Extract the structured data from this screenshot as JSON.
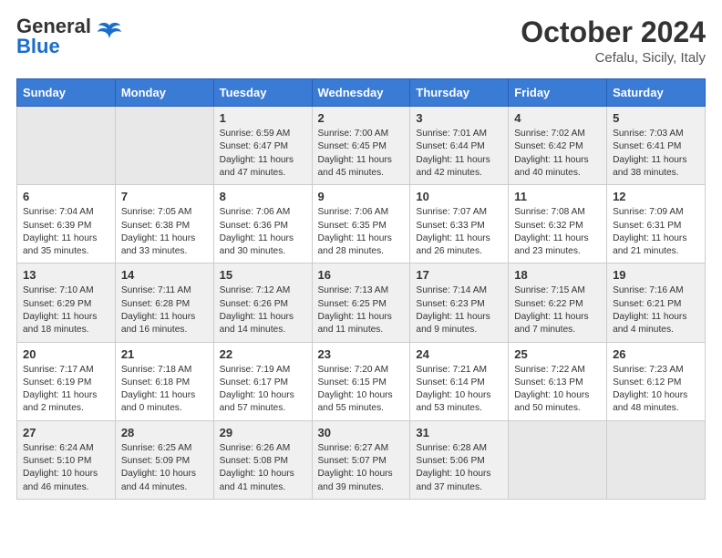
{
  "header": {
    "logo_general": "General",
    "logo_blue": "Blue",
    "month_title": "October 2024",
    "location": "Cefalu, Sicily, Italy"
  },
  "days_of_week": [
    "Sunday",
    "Monday",
    "Tuesday",
    "Wednesday",
    "Thursday",
    "Friday",
    "Saturday"
  ],
  "weeks": [
    [
      {
        "num": "",
        "empty": true
      },
      {
        "num": "",
        "empty": true
      },
      {
        "num": "1",
        "sunrise": "Sunrise: 6:59 AM",
        "sunset": "Sunset: 6:47 PM",
        "daylight": "Daylight: 11 hours and 47 minutes."
      },
      {
        "num": "2",
        "sunrise": "Sunrise: 7:00 AM",
        "sunset": "Sunset: 6:45 PM",
        "daylight": "Daylight: 11 hours and 45 minutes."
      },
      {
        "num": "3",
        "sunrise": "Sunrise: 7:01 AM",
        "sunset": "Sunset: 6:44 PM",
        "daylight": "Daylight: 11 hours and 42 minutes."
      },
      {
        "num": "4",
        "sunrise": "Sunrise: 7:02 AM",
        "sunset": "Sunset: 6:42 PM",
        "daylight": "Daylight: 11 hours and 40 minutes."
      },
      {
        "num": "5",
        "sunrise": "Sunrise: 7:03 AM",
        "sunset": "Sunset: 6:41 PM",
        "daylight": "Daylight: 11 hours and 38 minutes."
      }
    ],
    [
      {
        "num": "6",
        "sunrise": "Sunrise: 7:04 AM",
        "sunset": "Sunset: 6:39 PM",
        "daylight": "Daylight: 11 hours and 35 minutes."
      },
      {
        "num": "7",
        "sunrise": "Sunrise: 7:05 AM",
        "sunset": "Sunset: 6:38 PM",
        "daylight": "Daylight: 11 hours and 33 minutes."
      },
      {
        "num": "8",
        "sunrise": "Sunrise: 7:06 AM",
        "sunset": "Sunset: 6:36 PM",
        "daylight": "Daylight: 11 hours and 30 minutes."
      },
      {
        "num": "9",
        "sunrise": "Sunrise: 7:06 AM",
        "sunset": "Sunset: 6:35 PM",
        "daylight": "Daylight: 11 hours and 28 minutes."
      },
      {
        "num": "10",
        "sunrise": "Sunrise: 7:07 AM",
        "sunset": "Sunset: 6:33 PM",
        "daylight": "Daylight: 11 hours and 26 minutes."
      },
      {
        "num": "11",
        "sunrise": "Sunrise: 7:08 AM",
        "sunset": "Sunset: 6:32 PM",
        "daylight": "Daylight: 11 hours and 23 minutes."
      },
      {
        "num": "12",
        "sunrise": "Sunrise: 7:09 AM",
        "sunset": "Sunset: 6:31 PM",
        "daylight": "Daylight: 11 hours and 21 minutes."
      }
    ],
    [
      {
        "num": "13",
        "sunrise": "Sunrise: 7:10 AM",
        "sunset": "Sunset: 6:29 PM",
        "daylight": "Daylight: 11 hours and 18 minutes."
      },
      {
        "num": "14",
        "sunrise": "Sunrise: 7:11 AM",
        "sunset": "Sunset: 6:28 PM",
        "daylight": "Daylight: 11 hours and 16 minutes."
      },
      {
        "num": "15",
        "sunrise": "Sunrise: 7:12 AM",
        "sunset": "Sunset: 6:26 PM",
        "daylight": "Daylight: 11 hours and 14 minutes."
      },
      {
        "num": "16",
        "sunrise": "Sunrise: 7:13 AM",
        "sunset": "Sunset: 6:25 PM",
        "daylight": "Daylight: 11 hours and 11 minutes."
      },
      {
        "num": "17",
        "sunrise": "Sunrise: 7:14 AM",
        "sunset": "Sunset: 6:23 PM",
        "daylight": "Daylight: 11 hours and 9 minutes."
      },
      {
        "num": "18",
        "sunrise": "Sunrise: 7:15 AM",
        "sunset": "Sunset: 6:22 PM",
        "daylight": "Daylight: 11 hours and 7 minutes."
      },
      {
        "num": "19",
        "sunrise": "Sunrise: 7:16 AM",
        "sunset": "Sunset: 6:21 PM",
        "daylight": "Daylight: 11 hours and 4 minutes."
      }
    ],
    [
      {
        "num": "20",
        "sunrise": "Sunrise: 7:17 AM",
        "sunset": "Sunset: 6:19 PM",
        "daylight": "Daylight: 11 hours and 2 minutes."
      },
      {
        "num": "21",
        "sunrise": "Sunrise: 7:18 AM",
        "sunset": "Sunset: 6:18 PM",
        "daylight": "Daylight: 11 hours and 0 minutes."
      },
      {
        "num": "22",
        "sunrise": "Sunrise: 7:19 AM",
        "sunset": "Sunset: 6:17 PM",
        "daylight": "Daylight: 10 hours and 57 minutes."
      },
      {
        "num": "23",
        "sunrise": "Sunrise: 7:20 AM",
        "sunset": "Sunset: 6:15 PM",
        "daylight": "Daylight: 10 hours and 55 minutes."
      },
      {
        "num": "24",
        "sunrise": "Sunrise: 7:21 AM",
        "sunset": "Sunset: 6:14 PM",
        "daylight": "Daylight: 10 hours and 53 minutes."
      },
      {
        "num": "25",
        "sunrise": "Sunrise: 7:22 AM",
        "sunset": "Sunset: 6:13 PM",
        "daylight": "Daylight: 10 hours and 50 minutes."
      },
      {
        "num": "26",
        "sunrise": "Sunrise: 7:23 AM",
        "sunset": "Sunset: 6:12 PM",
        "daylight": "Daylight: 10 hours and 48 minutes."
      }
    ],
    [
      {
        "num": "27",
        "sunrise": "Sunrise: 6:24 AM",
        "sunset": "Sunset: 5:10 PM",
        "daylight": "Daylight: 10 hours and 46 minutes."
      },
      {
        "num": "28",
        "sunrise": "Sunrise: 6:25 AM",
        "sunset": "Sunset: 5:09 PM",
        "daylight": "Daylight: 10 hours and 44 minutes."
      },
      {
        "num": "29",
        "sunrise": "Sunrise: 6:26 AM",
        "sunset": "Sunset: 5:08 PM",
        "daylight": "Daylight: 10 hours and 41 minutes."
      },
      {
        "num": "30",
        "sunrise": "Sunrise: 6:27 AM",
        "sunset": "Sunset: 5:07 PM",
        "daylight": "Daylight: 10 hours and 39 minutes."
      },
      {
        "num": "31",
        "sunrise": "Sunrise: 6:28 AM",
        "sunset": "Sunset: 5:06 PM",
        "daylight": "Daylight: 10 hours and 37 minutes."
      },
      {
        "num": "",
        "empty": true
      },
      {
        "num": "",
        "empty": true
      }
    ]
  ]
}
